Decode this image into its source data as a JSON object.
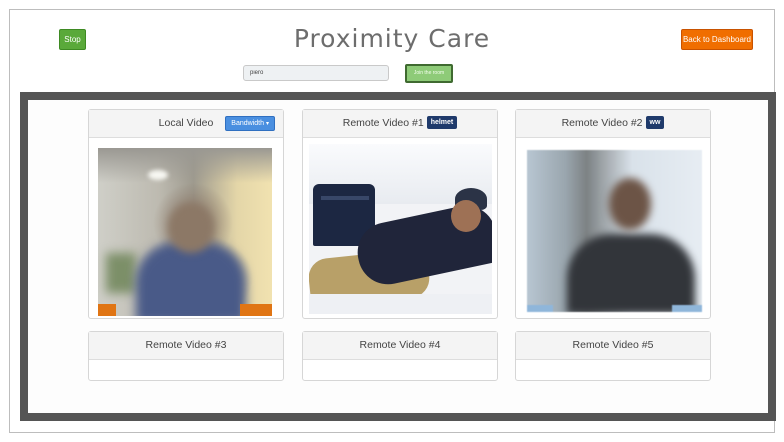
{
  "header": {
    "stop_label": "Stop",
    "title": "Proximity Care",
    "back_label": "Back to Dashboard"
  },
  "room": {
    "value": "piero",
    "join_label": "Join the room"
  },
  "videos": {
    "local": {
      "title": "Local Video",
      "bandwidth_label": "Bandwidth"
    },
    "remote1": {
      "title": "Remote Video #1",
      "badge": "helmet"
    },
    "remote2": {
      "title": "Remote Video #2",
      "badge": "ww"
    },
    "remote3": {
      "title": "Remote Video #3"
    },
    "remote4": {
      "title": "Remote Video #4"
    },
    "remote5": {
      "title": "Remote Video #5"
    }
  },
  "colors": {
    "stop": "#5aa93a",
    "back": "#f06e00",
    "join": "#8ecb78",
    "badge": "#1f3a6b",
    "bandwidth": "#4a8fe0",
    "stage_border": "#555555"
  }
}
